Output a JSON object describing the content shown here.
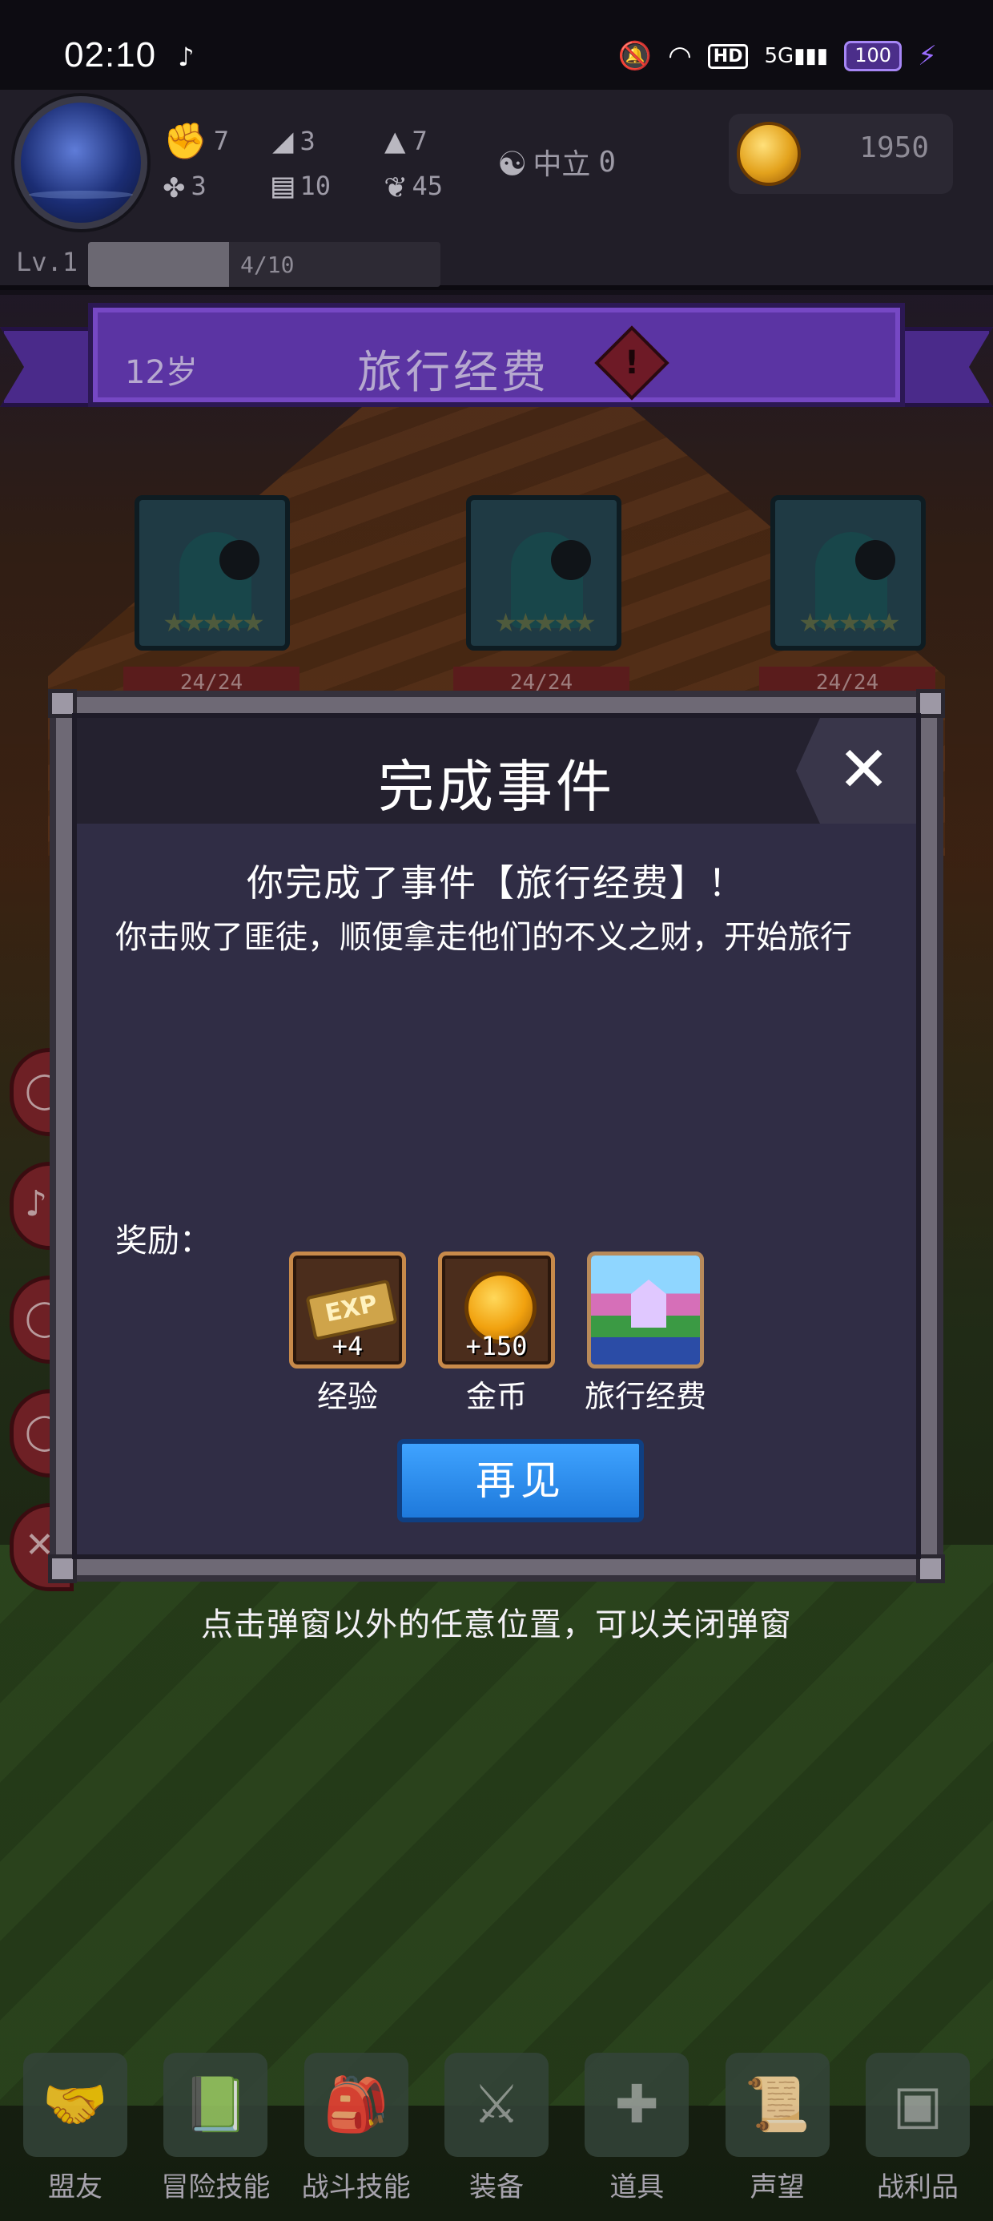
{
  "status_bar": {
    "time": "02:10",
    "network": "5G",
    "hd": "HD",
    "battery": "100"
  },
  "hud": {
    "stats": [
      {
        "icon": "fist-icon",
        "value": "7"
      },
      {
        "icon": "clover-icon",
        "value": "3"
      },
      {
        "icon": "boot-icon",
        "value": "3"
      },
      {
        "icon": "book-icon",
        "value": "10"
      },
      {
        "icon": "wizard-hat-icon",
        "value": "7"
      },
      {
        "icon": "lotus-icon",
        "value": "45"
      }
    ],
    "alignment_label": "中立",
    "alignment_value": "0",
    "gold": "1950",
    "level": "Lv.1",
    "xp_text": "4/10",
    "xp_fraction": 0.4
  },
  "banner": {
    "age": "12岁",
    "title": "旅行经费",
    "alert": "!"
  },
  "enemies": [
    {
      "hp": "24/24"
    },
    {
      "hp": "24/24"
    },
    {
      "hp": "24/24"
    }
  ],
  "dialog": {
    "title": "完成事件",
    "close": "✕",
    "subtitle": "你完成了事件【旅行经费】！",
    "body": "你击败了匪徒，顺便拿走他们的不义之财，开始旅行",
    "reward_label": "奖励：",
    "rewards": [
      {
        "name": "经验",
        "qty": "+4",
        "badge": "EXP"
      },
      {
        "name": "金币",
        "qty": "+150"
      },
      {
        "name": "旅行经费",
        "qty": ""
      }
    ],
    "button": "再见"
  },
  "hint": "点击弹窗以外的任意位置，可以关闭弹窗",
  "nav": [
    {
      "label": "盟友",
      "icon": "handshake-icon"
    },
    {
      "label": "冒险技能",
      "icon": "spellbook-icon"
    },
    {
      "label": "战斗技能",
      "icon": "backpack-icon"
    },
    {
      "label": "装备",
      "icon": "crossed-swords-icon"
    },
    {
      "label": "道具",
      "icon": "pouch-icon"
    },
    {
      "label": "声望",
      "icon": "scroll-icon"
    },
    {
      "label": "战利品",
      "icon": "treasure-chest-icon"
    }
  ]
}
